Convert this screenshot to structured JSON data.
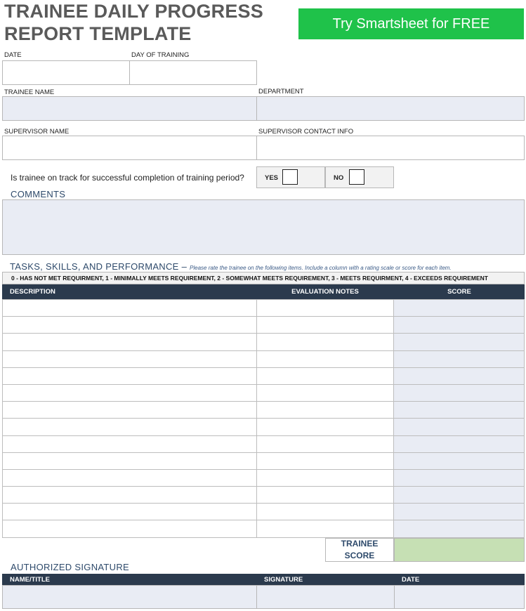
{
  "header": {
    "title_line1": "TRAINEE DAILY PROGRESS",
    "title_line2": "REPORT TEMPLATE",
    "cta_label": "Try Smartsheet for FREE"
  },
  "fields": {
    "date": "DATE",
    "day_of_training": "DAY OF TRAINING",
    "trainee_name": "TRAINEE NAME",
    "department": "DEPARTMENT",
    "supervisor_name": "SUPERVISOR NAME",
    "supervisor_contact": "SUPERVISOR CONTACT INFO"
  },
  "on_track": {
    "question": "Is trainee on track for successful completion of training period?",
    "yes": "YES",
    "no": "NO"
  },
  "comments": {
    "heading": "COMMENTS"
  },
  "tasks": {
    "heading": "TASKS, SKILLS, AND PERFORMANCE",
    "dash": " – ",
    "note": "Please rate the trainee on the following items. Include a column with a rating scale or score for each item.",
    "scale": "0 - HAS NOT MET REQUIRMENT, 1 - MINIMALLY MEETS REQUIREMENT, 2 - SOMEWHAT MEETS REQUIREMENT, 3 - MEETS REQUIRMENT, 4 - EXCEEDS REQUIREMENT",
    "columns": {
      "description": "DESCRIPTION",
      "evaluation": "EVALUATION NOTES",
      "score": "SCORE"
    },
    "row_count": 14,
    "trainee_score_line1": "TRAINEE",
    "trainee_score_line2": "SCORE"
  },
  "signature": {
    "heading": "AUTHORIZED SIGNATURE",
    "columns": {
      "name_title": "NAME/TITLE",
      "signature": "SIGNATURE",
      "date": "DATE"
    }
  },
  "colors": {
    "cta": "#1fc24a",
    "header_dark": "#2b3a4d",
    "shade": "#e9ecf4",
    "score_total": "#c6e0b4"
  }
}
